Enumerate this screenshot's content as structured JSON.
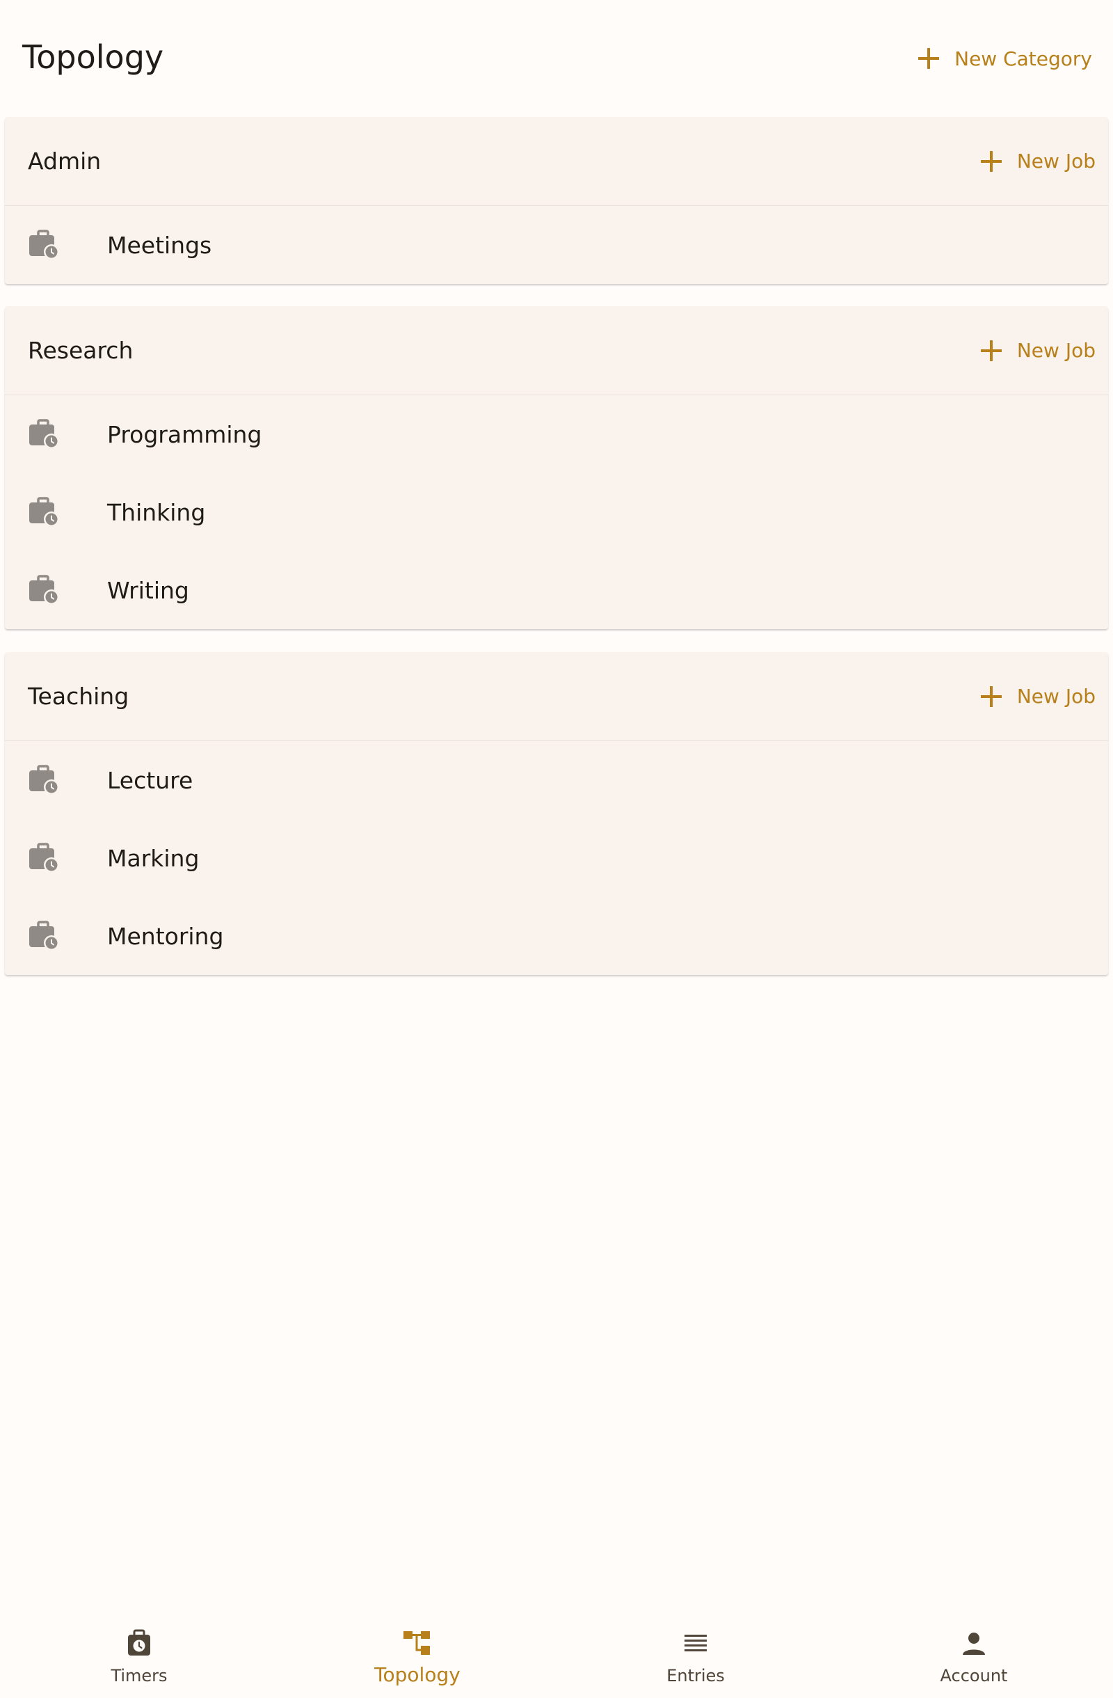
{
  "header": {
    "title": "Topology",
    "new_category_label": "New Category"
  },
  "categories": [
    {
      "name": "Admin",
      "new_job_label": "New Job",
      "jobs": [
        {
          "label": "Meetings"
        }
      ]
    },
    {
      "name": "Research",
      "new_job_label": "New Job",
      "jobs": [
        {
          "label": "Programming"
        },
        {
          "label": "Thinking"
        },
        {
          "label": "Writing"
        }
      ]
    },
    {
      "name": "Teaching",
      "new_job_label": "New Job",
      "jobs": [
        {
          "label": "Lecture"
        },
        {
          "label": "Marking"
        },
        {
          "label": "Mentoring"
        }
      ]
    }
  ],
  "bottom_nav": {
    "items": [
      {
        "label": "Timers",
        "icon": "timer-bag-icon"
      },
      {
        "label": "Topology",
        "icon": "topology-icon",
        "active": true
      },
      {
        "label": "Entries",
        "icon": "list-icon"
      },
      {
        "label": "Account",
        "icon": "person-icon"
      }
    ]
  },
  "colors": {
    "accent": "#b8801a",
    "background": "#fffcfa",
    "card": "#faf3ed",
    "icon_grey": "#8f8a85"
  }
}
